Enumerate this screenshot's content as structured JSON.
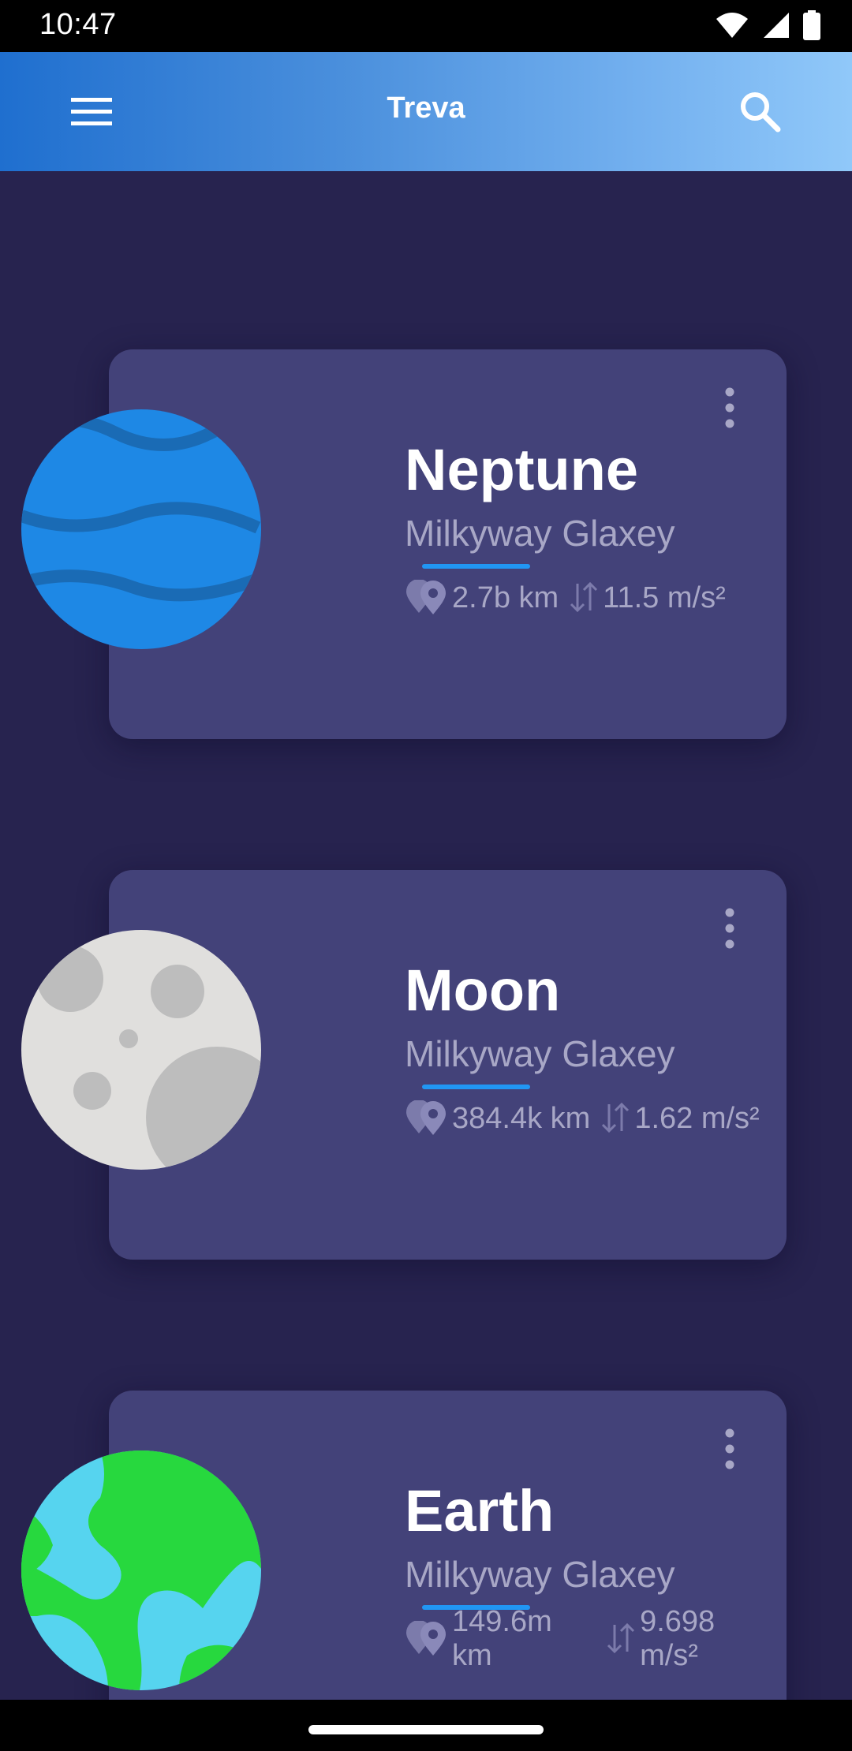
{
  "status_bar": {
    "time": "10:47"
  },
  "app_bar": {
    "title": "Treva",
    "menu_icon": "hamburger-menu-icon",
    "search_icon": "search-icon"
  },
  "planets": [
    {
      "name": "Neptune",
      "galaxy": "Milkyway Glaxey",
      "distance": "2.7b km",
      "gravity": "11.5 m/s²",
      "icon": "neptune-planet-icon"
    },
    {
      "name": "Moon",
      "galaxy": "Milkyway Glaxey",
      "distance": "384.4k km",
      "gravity": "1.62 m/s²",
      "icon": "moon-planet-icon"
    },
    {
      "name": "Earth",
      "galaxy": "Milkyway Glaxey",
      "distance": "149.6m km",
      "gravity": "9.698 m/s²",
      "icon": "earth-planet-icon"
    }
  ],
  "colors": {
    "background": "#27234f",
    "card": "#434279",
    "accent": "#2196f3",
    "secondary_text": "#a8a7c6"
  }
}
